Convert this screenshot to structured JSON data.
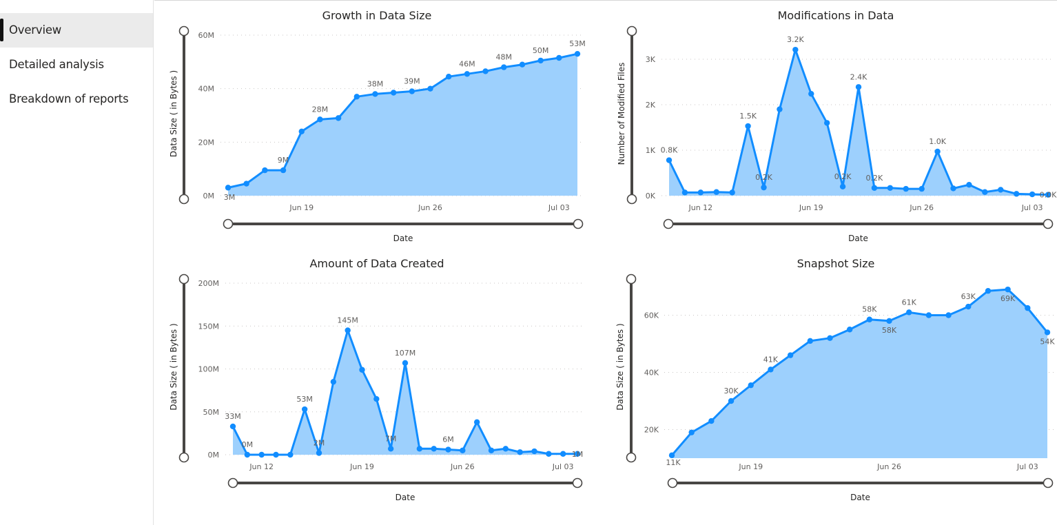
{
  "sidebar": {
    "items": [
      {
        "label": "Overview",
        "active": true
      },
      {
        "label": "Detailed analysis",
        "active": false
      },
      {
        "label": "Breakdown of reports",
        "active": false
      }
    ]
  },
  "colors": {
    "line": "#118dff",
    "area": "#9dd0fd",
    "grid": "#c8c6c4",
    "slider": "#484644"
  },
  "chart_data": [
    {
      "id": "growth",
      "type": "area",
      "title": "Growth in Data Size",
      "xlabel": "Date",
      "ylabel": "Data Size ( in Bytes )",
      "x": [
        "Jun 15",
        "Jun 16",
        "Jun 17",
        "Jun 18",
        "Jun 19",
        "Jun 20",
        "Jun 21",
        "Jun 22",
        "Jun 23",
        "Jun 24",
        "Jun 25",
        "Jun 26",
        "Jun 27",
        "Jun 28",
        "Jun 29",
        "Jun 30",
        "Jul 01",
        "Jul 02",
        "Jul 03",
        "Jul 04"
      ],
      "values": [
        3,
        4.5,
        9.5,
        9.5,
        24,
        28.5,
        29,
        37,
        38,
        38.5,
        39,
        40,
        44.5,
        45.5,
        46.5,
        48,
        49,
        50.5,
        51.5,
        53
      ],
      "unit": "M",
      "ylim": [
        0,
        60
      ],
      "yticks": [
        {
          "v": 0,
          "label": "0M"
        },
        {
          "v": 20,
          "label": "20M"
        },
        {
          "v": 40,
          "label": "40M"
        },
        {
          "v": 60,
          "label": "60M"
        }
      ],
      "xticks": [
        {
          "i": 4,
          "label": "Jun 19"
        },
        {
          "i": 11,
          "label": "Jun 26"
        },
        {
          "i": 18,
          "label": "Jul 03"
        }
      ],
      "data_labels": [
        {
          "i": 0,
          "label": "3M",
          "pos": "below"
        },
        {
          "i": 3,
          "label": "9M",
          "pos": "above"
        },
        {
          "i": 5,
          "label": "28M",
          "pos": "above"
        },
        {
          "i": 8,
          "label": "38M",
          "pos": "above"
        },
        {
          "i": 10,
          "label": "39M",
          "pos": "above"
        },
        {
          "i": 13,
          "label": "46M",
          "pos": "above"
        },
        {
          "i": 15,
          "label": "48M",
          "pos": "above"
        },
        {
          "i": 17,
          "label": "50M",
          "pos": "above"
        },
        {
          "i": 19,
          "label": "53M",
          "pos": "above"
        }
      ],
      "grid": true
    },
    {
      "id": "mods",
      "type": "area",
      "title": "Modifications in Data",
      "xlabel": "Date",
      "ylabel": "Number of Modified Files",
      "x": [
        "Jun 10",
        "Jun 11",
        "Jun 12",
        "Jun 13",
        "Jun 14",
        "Jun 15",
        "Jun 16",
        "Jun 17",
        "Jun 18",
        "Jun 19",
        "Jun 20",
        "Jun 21",
        "Jun 22",
        "Jun 23",
        "Jun 24",
        "Jun 25",
        "Jun 26",
        "Jun 27",
        "Jun 28",
        "Jun 29",
        "Jun 30",
        "Jul 01",
        "Jul 02",
        "Jul 03",
        "Jul 04"
      ],
      "values": [
        0.78,
        0.07,
        0.07,
        0.08,
        0.07,
        1.53,
        0.18,
        1.9,
        3.21,
        2.24,
        1.6,
        0.2,
        2.39,
        0.17,
        0.17,
        0.15,
        0.15,
        0.97,
        0.16,
        0.24,
        0.08,
        0.13,
        0.04,
        0.03,
        0.02
      ],
      "unit": "K",
      "ylim": [
        0,
        3.3
      ],
      "yticks": [
        {
          "v": 0,
          "label": "0K"
        },
        {
          "v": 1,
          "label": "1K"
        },
        {
          "v": 2,
          "label": "2K"
        },
        {
          "v": 3,
          "label": "3K"
        }
      ],
      "xticks": [
        {
          "i": 2,
          "label": "Jun 12"
        },
        {
          "i": 9,
          "label": "Jun 19"
        },
        {
          "i": 16,
          "label": "Jun 26"
        },
        {
          "i": 23,
          "label": "Jul 03"
        }
      ],
      "data_labels": [
        {
          "i": 0,
          "label": "0.8K",
          "pos": "above"
        },
        {
          "i": 5,
          "label": "1.5K",
          "pos": "above"
        },
        {
          "i": 6,
          "label": "0.2K",
          "pos": "above"
        },
        {
          "i": 8,
          "label": "3.2K",
          "pos": "above"
        },
        {
          "i": 11,
          "label": "0.2K",
          "pos": "above"
        },
        {
          "i": 12,
          "label": "2.4K",
          "pos": "above"
        },
        {
          "i": 13,
          "label": "0.2K",
          "pos": "above"
        },
        {
          "i": 17,
          "label": "1.0K",
          "pos": "above"
        },
        {
          "i": 24,
          "label": "0.0K",
          "pos": "right"
        }
      ],
      "grid": true
    },
    {
      "id": "created",
      "type": "area",
      "title": "Amount of Data Created",
      "xlabel": "Date",
      "ylabel": "Data Size ( in Bytes )",
      "x": [
        "Jun 10",
        "Jun 11",
        "Jun 12",
        "Jun 13",
        "Jun 14",
        "Jun 15",
        "Jun 16",
        "Jun 17",
        "Jun 18",
        "Jun 19",
        "Jun 20",
        "Jun 21",
        "Jun 22",
        "Jun 23",
        "Jun 24",
        "Jun 25",
        "Jun 26",
        "Jun 27",
        "Jun 28",
        "Jun 29",
        "Jun 30",
        "Jul 01",
        "Jul 02",
        "Jul 03",
        "Jul 04"
      ],
      "values": [
        33,
        0,
        0,
        0,
        0,
        53,
        2,
        85,
        145,
        99,
        65,
        7,
        107,
        7,
        7,
        6,
        5,
        38,
        5,
        7,
        3,
        4,
        1,
        1,
        1
      ],
      "unit": "M",
      "ylim": [
        0,
        200
      ],
      "yticks": [
        {
          "v": 0,
          "label": "0M"
        },
        {
          "v": 50,
          "label": "50M"
        },
        {
          "v": 100,
          "label": "100M"
        },
        {
          "v": 150,
          "label": "150M"
        },
        {
          "v": 200,
          "label": "200M"
        }
      ],
      "xticks": [
        {
          "i": 2,
          "label": "Jun 12"
        },
        {
          "i": 9,
          "label": "Jun 19"
        },
        {
          "i": 16,
          "label": "Jun 26"
        },
        {
          "i": 23,
          "label": "Jul 03"
        }
      ],
      "data_labels": [
        {
          "i": 0,
          "label": "33M",
          "pos": "above"
        },
        {
          "i": 1,
          "label": "0M",
          "pos": "above"
        },
        {
          "i": 5,
          "label": "53M",
          "pos": "above"
        },
        {
          "i": 6,
          "label": "2M",
          "pos": "above"
        },
        {
          "i": 8,
          "label": "145M",
          "pos": "above"
        },
        {
          "i": 11,
          "label": "7M",
          "pos": "above"
        },
        {
          "i": 12,
          "label": "107M",
          "pos": "above"
        },
        {
          "i": 15,
          "label": "6M",
          "pos": "above"
        },
        {
          "i": 24,
          "label": "1M",
          "pos": "right"
        }
      ],
      "grid": true
    },
    {
      "id": "snapshot",
      "type": "area",
      "title": "Snapshot Size",
      "xlabel": "Date",
      "ylabel": "Data Size ( in Bytes )",
      "x": [
        "Jun 15",
        "Jun 16",
        "Jun 17",
        "Jun 18",
        "Jun 19",
        "Jun 20",
        "Jun 21",
        "Jun 22",
        "Jun 23",
        "Jun 24",
        "Jun 25",
        "Jun 26",
        "Jun 27",
        "Jun 28",
        "Jun 29",
        "Jun 30",
        "Jul 01",
        "Jul 02",
        "Jul 03",
        "Jul 04"
      ],
      "values": [
        11,
        19,
        23,
        30,
        35.5,
        41,
        46,
        51,
        52,
        55,
        58.5,
        58,
        61,
        60,
        60,
        63,
        68.5,
        69,
        62.5,
        54
      ],
      "unit": "K",
      "ylim": [
        10,
        72
      ],
      "yticks": [
        {
          "v": 20,
          "label": "20K"
        },
        {
          "v": 40,
          "label": "40K"
        },
        {
          "v": 60,
          "label": "60K"
        }
      ],
      "xticks": [
        {
          "i": 4,
          "label": "Jun 19"
        },
        {
          "i": 11,
          "label": "Jun 26"
        },
        {
          "i": 18,
          "label": "Jul 03"
        }
      ],
      "data_labels": [
        {
          "i": 0,
          "label": "11K",
          "pos": "below"
        },
        {
          "i": 3,
          "label": "30K",
          "pos": "above"
        },
        {
          "i": 5,
          "label": "41K",
          "pos": "above"
        },
        {
          "i": 10,
          "label": "58K",
          "pos": "above"
        },
        {
          "i": 11,
          "label": "58K",
          "pos": "below"
        },
        {
          "i": 12,
          "label": "61K",
          "pos": "above"
        },
        {
          "i": 15,
          "label": "63K",
          "pos": "above"
        },
        {
          "i": 17,
          "label": "69K",
          "pos": "below"
        },
        {
          "i": 19,
          "label": "54K",
          "pos": "below"
        }
      ],
      "grid": true
    }
  ]
}
